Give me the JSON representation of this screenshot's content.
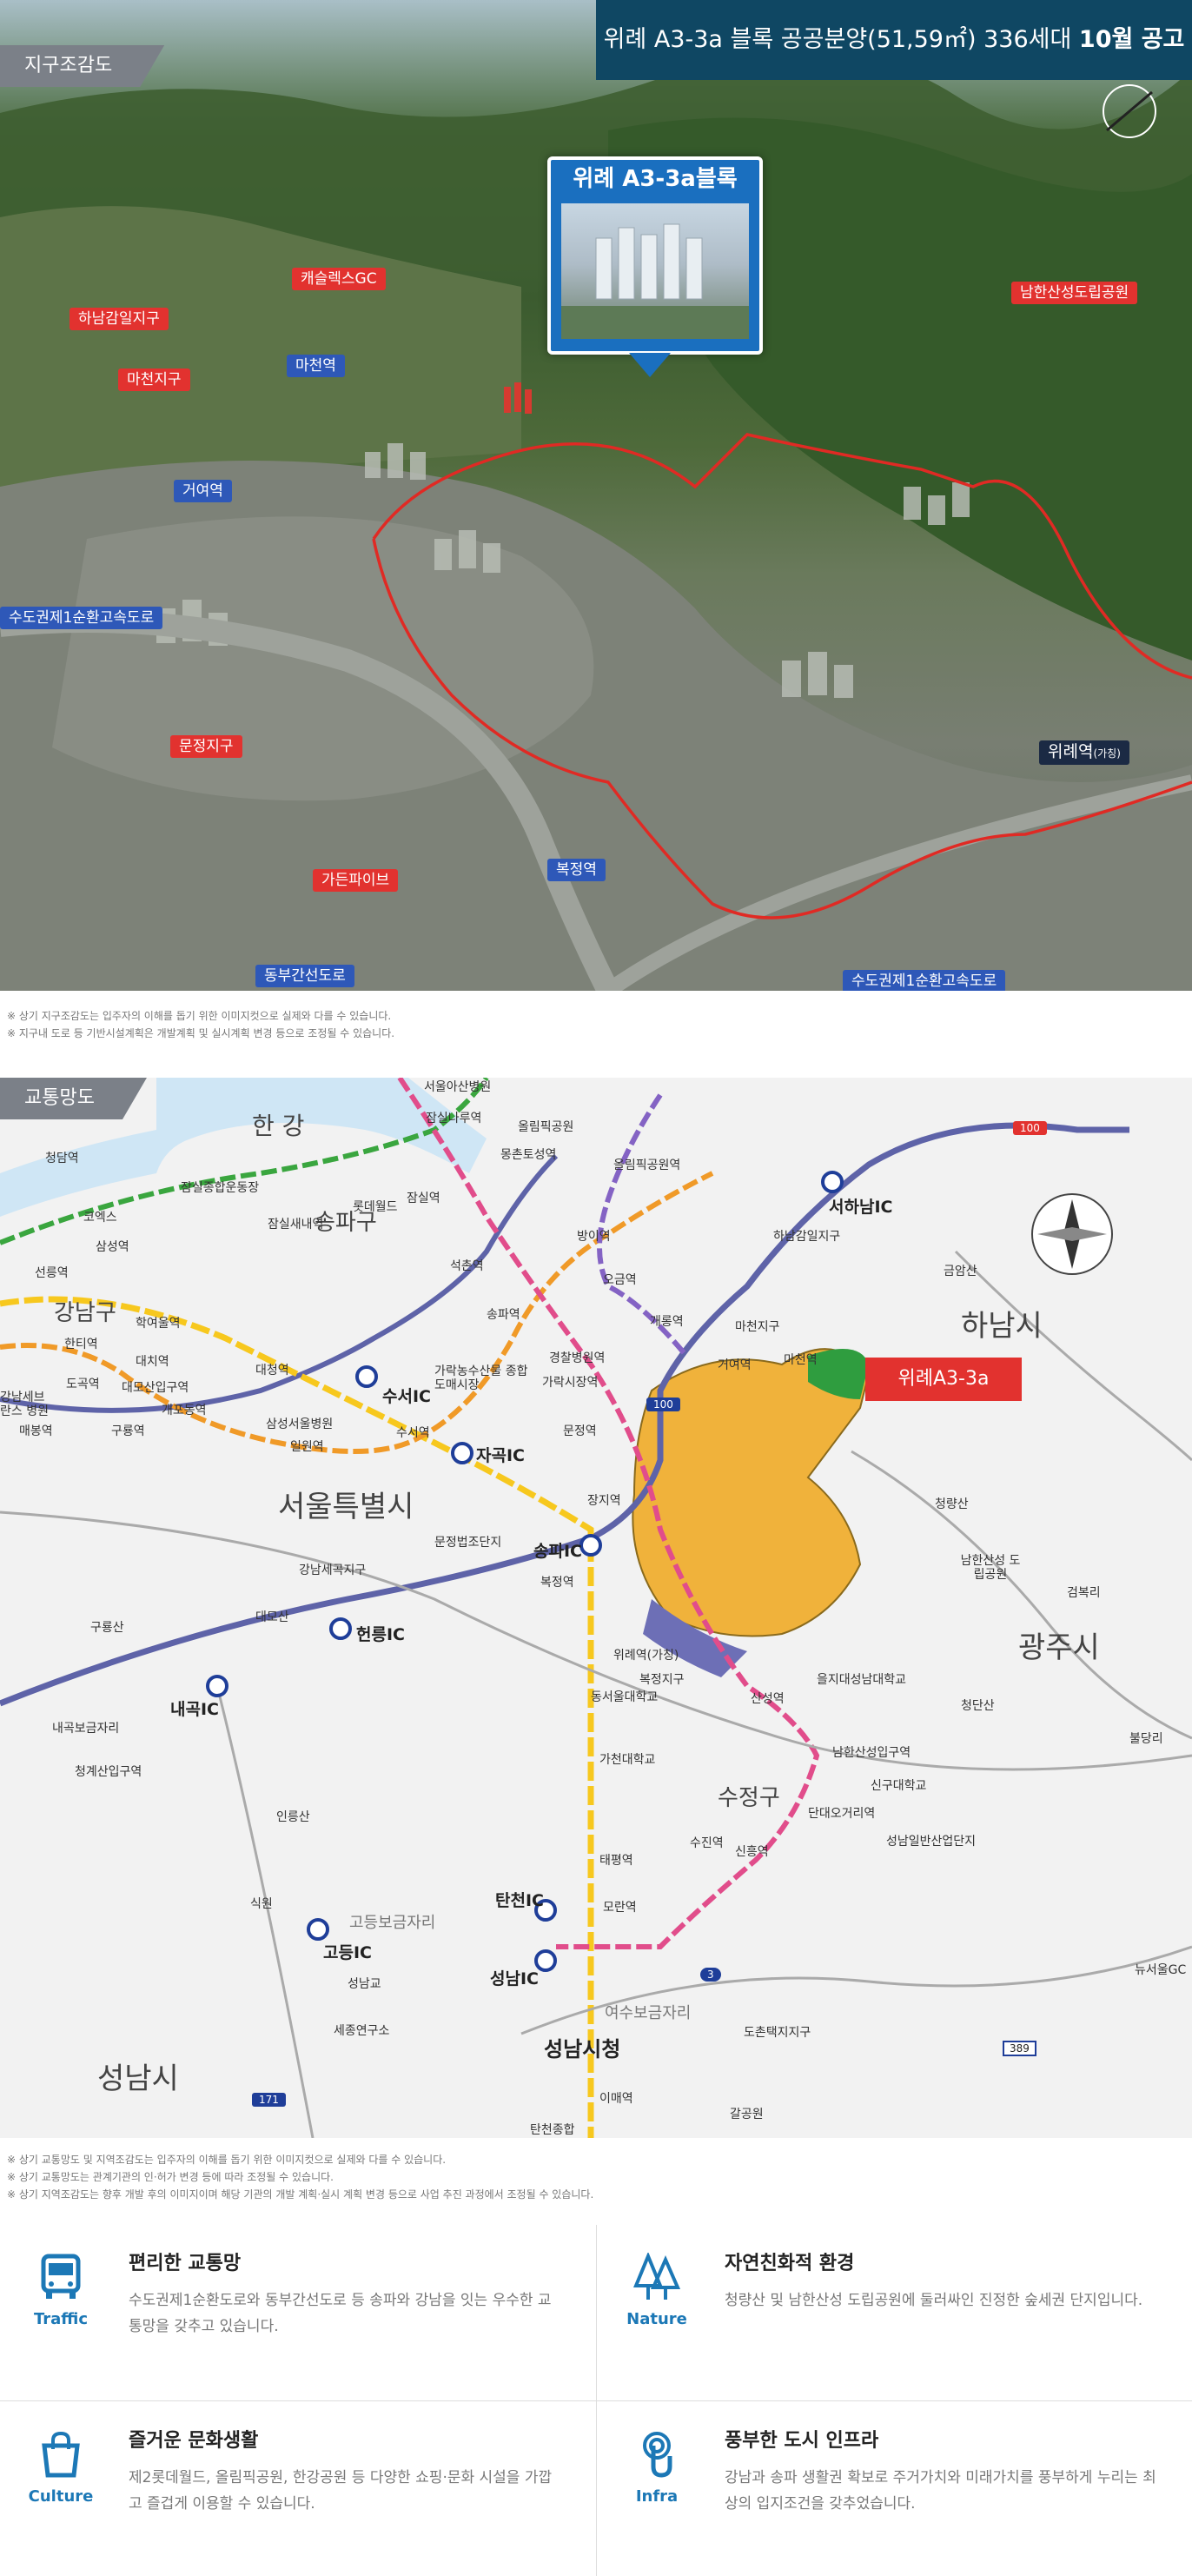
{
  "aerial": {
    "section_tag": "지구조감도",
    "notice": {
      "prefix": "위례 A3-3a 블록 공공분양(51,59㎡) 336세대 ",
      "emphasis": "10월 공고"
    },
    "callout_title": "위례 A3-3a블록",
    "labels": {
      "ceres_gc": "캐슬렉스GC",
      "hanam_gamil": "하남감일지구",
      "macheon_station": "마천역",
      "namhansan_park": "남한산성도립공원",
      "macheon_district": "마천지구",
      "geoyeo_station": "거여역",
      "ring_road_left": "수도권제1순환고속도로",
      "munjeong": "문정지구",
      "wirye_station": "위례역",
      "wirye_station_note": "(가칭)",
      "bokjeong_station": "복정역",
      "garden_five": "가든파이브",
      "dongbu_expressway": "동부간선도로",
      "ring_road_right": "수도권제1순환고속도로"
    },
    "notes": [
      "※ 상기 지구조감도는 입주자의 이해를 돕기 위한 이미지컷으로 실제와 다를 수 있습니다.",
      "※ 지구내 도로 등 기반시설계획은 개발계획 및 실시계획 변경 등으로 조정될 수 있습니다."
    ]
  },
  "traffic": {
    "section_tag": "교통망도",
    "pin_label": "위례A3-3a",
    "areas": {
      "hangang": "한 강",
      "songpa": "송파구",
      "gangnam": "강남구",
      "seoul": "서울특별시",
      "hanam": "하남시",
      "gwangju": "광주시",
      "sujeong": "수정구",
      "seongnam": "성남시",
      "seongnam_city_hall": "성남시청"
    },
    "ics": {
      "seohanam": "서하남IC",
      "suseo": "수서IC",
      "jagok": "자곡IC",
      "songpa": "송파IC",
      "heolleung": "헌릉IC",
      "naegok": "내곡IC",
      "gogdeung": "고등IC",
      "tancheon": "탄천IC",
      "seongnam": "성남IC"
    },
    "places": {
      "seoul_asan": "서울아산병원",
      "jamsil_naru": "잠실나루역",
      "olympic_park": "올림픽공원",
      "mongchontoseong": "몽촌토성역",
      "olympic_park_st": "올림픽공원역",
      "cheongdam": "청담역",
      "jamsil_sports": "잠실종합운동장",
      "coex": "코엑스",
      "samseong": "삼성역",
      "jamsilsaenae": "잠실새내역",
      "lotte_world": "롯데월드",
      "jamsil": "잠실역",
      "bangi": "방이역",
      "seonneung": "선릉역",
      "seokchon": "석촌역",
      "ogeum": "오금역",
      "gaerong": "개롱역",
      "hanam_gamil": "하남감일지구",
      "geumam": "금암산",
      "hanti": "한티역",
      "hagyeo_ul": "학여울역",
      "songpa": "송파역",
      "macheon_district": "마천지구",
      "geoyeo": "거여역",
      "macheon": "마천역",
      "daechi": "대치역",
      "daecheong": "대청역",
      "garak_market": "가락농수산물 종합도매시장",
      "gyeongchal": "경찰병원역",
      "garak": "가락시장역",
      "dogok": "도곡역",
      "daemo": "대모산입구역",
      "gaepo": "개포동역",
      "samsung_med": "삼성서울병원",
      "guryong": "구룡역",
      "ilwon": "일원역",
      "suseo": "수서역",
      "munjeong": "문정역",
      "maebong": "매봉역",
      "jangji": "장지역",
      "cheongnyang": "청량산",
      "gangnam_severance": "강남세브란스 병원",
      "namhansanseong": "남한산성 도립공원",
      "gangnam_sewol": "강남세곡지구",
      "munjeong_legal": "문정법조단지",
      "bokjeong": "복정역",
      "gumgok": "검복리",
      "daemosan": "대모산",
      "gunyongsan": "구룡산",
      "wirye_st": "위례역(가칭)",
      "bokjeong_district": "복정지구",
      "dongseoul_univ": "동서울대학교",
      "sansung": "산성역",
      "eulji_univ": "을지대성남대학교",
      "namhansan_gate": "남한산성입구역",
      "singu_univ": "신구대학교",
      "cheongdangu": "청단산",
      "naegok_district": "내곡보금자리",
      "cheonggye": "청계산입구역",
      "gachon_univ": "가천대학교",
      "dandaeogeori": "단대오거리역",
      "bundang": "불당리",
      "inneungsan": "인릉산",
      "taepyeong": "태평역",
      "sujin": "수진역",
      "sinheung": "신흥역",
      "seongnam_industrial": "성남일반산업단지",
      "siksan": "식원",
      "moran": "모란역",
      "godeung_bogeum": "고등보금자리",
      "yeosu_bogeum": "여수보금자리",
      "sinchon_univ": "성남교",
      "jumin_gc": "뉴서울GC",
      "seongnam_park": "세종연구소",
      "doch_on": "도촌택지지구",
      "gal_park": "갈공원",
      "imae": "이매역",
      "bundang_complex": "탄천종합"
    },
    "roads": {
      "r100_top": "100",
      "r100_mid": "100",
      "r3": "3",
      "r389": "389",
      "r171": "171"
    },
    "notes": [
      "※ 상기 교통망도 및 지역조감도는 입주자의 이해를 돕기 위한 이미지컷으로 실제와 다를 수 있습니다.",
      "※ 상기 교통망도는 관계기관의 인·허가 변경 등에 따라 조정될 수 있습니다.",
      "※ 상기 지역조감도는 향후 개발 후의 이미지이며 해당 기관의 개발 계획·실시 계획 변경 등으로 사업 추진 과정에서 조정될 수 있습니다."
    ]
  },
  "features": [
    {
      "en": "Traffic",
      "title": "편리한 교통망",
      "desc": "수도권제1순환도로와 동부간선도로 등 송파와 강남을 잇는 우수한 교통망을 갖추고 있습니다."
    },
    {
      "en": "Nature",
      "title": "자연친화적 환경",
      "desc": "청량산 및 남한산성 도립공원에 둘러싸인 진정한 숲세권 단지입니다."
    },
    {
      "en": "Culture",
      "title": "즐거운 문화생활",
      "desc": "제2롯데월드, 올림픽공원, 한강공원 등 다양한 쇼핑·문화 시설을 가깝고 즐겁게 이용할 수 있습니다."
    },
    {
      "en": "Infra",
      "title": "풍부한 도시 인프라",
      "desc": "강남과 송파 생활권 확보로 주거가치와 미래가치를 풍부하게 누리는 최상의 입지조건을 갖추었습니다."
    }
  ],
  "colors": {
    "brand_blue": "#1c78b6",
    "notice_bg": "#0f4763",
    "label_red": "#e2322f",
    "label_blue": "#2e58b8"
  }
}
